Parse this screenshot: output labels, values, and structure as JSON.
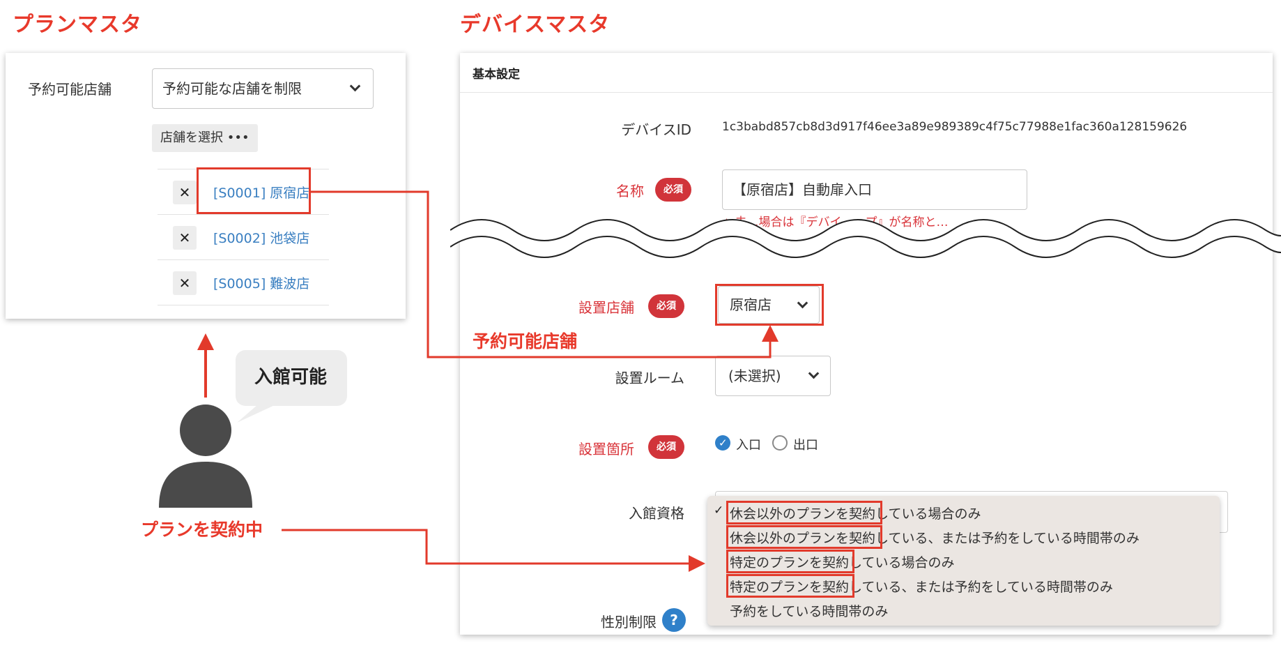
{
  "titles": {
    "plan_master": "プランマスタ",
    "device_master": "デバイスマスタ"
  },
  "plan_panel": {
    "field_label": "予約可能店舗",
    "select_value": "予約可能な店舗を制限",
    "select_store_button": "店舗を選択 •••",
    "remove_icon": "✕",
    "stores": [
      "[S0001] 原宿店",
      "[S0002] 池袋店",
      "[S0005] 難波店"
    ]
  },
  "person": {
    "speech": "入館可能",
    "caption": "プランを契約中"
  },
  "device_panel": {
    "header": "基本設定",
    "device_id_label": "デバイスID",
    "device_id_value": "1c3babd857cb8d3d917f46ee3a89e989389c4f75c77988e1fac360a128159626",
    "name_label": "名称",
    "required_badge": "必須",
    "name_value": "【原宿店】自動扉入口",
    "warning_text": "未…場合は『デバイ…ップ』が名称と…",
    "store_label": "設置店舗",
    "store_value": "原宿店",
    "room_label": "設置ルーム",
    "room_value": "(未選択)",
    "location_label": "設置箇所",
    "location_options": [
      "入口",
      "出口"
    ],
    "location_selected": "入口",
    "entry_label": "入館資格",
    "entry_options": [
      "休会以外のプランを契約している場合のみ",
      "休会以外のプランを契約している、または予約をしている時間帯のみ",
      "特定のプランを契約している場合のみ",
      "特定のプランを契約している、または予約をしている時間帯のみ",
      "予約をしている時間帯のみ"
    ],
    "entry_highlight_parts": [
      "休会以外のプランを契約",
      "休会以外のプランを契約",
      "特定のプランを契約",
      "特定のプランを契約"
    ],
    "entry_rest_parts": [
      "している場合のみ",
      "している、または予約をしている時間帯のみ",
      "している場合のみ",
      "している、または予約をしている時間帯のみ"
    ],
    "gender_label": "性別制限",
    "help_icon": "?"
  },
  "annotations": {
    "store_arrow_label": "予約可能店舗"
  },
  "colors": {
    "accent_red": "#e8392b",
    "required_red": "#d1343a",
    "link_blue": "#3a7fc1",
    "check_blue": "#2f80c9"
  }
}
